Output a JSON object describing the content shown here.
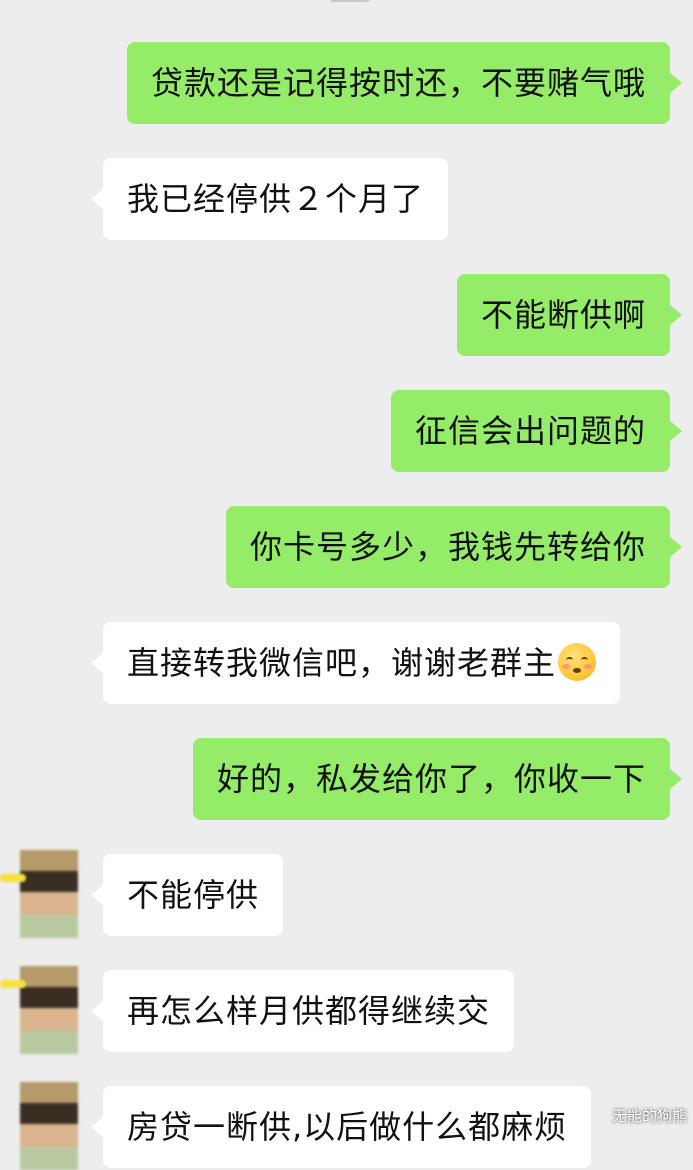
{
  "messages": [
    {
      "side": "sent",
      "text": "贷款还是记得按时还，不要赌气哦"
    },
    {
      "side": "received",
      "text": "我已经停供２个月了"
    },
    {
      "side": "sent",
      "text": "不能断供啊"
    },
    {
      "side": "sent",
      "text": "征信会出问题的"
    },
    {
      "side": "sent",
      "text": "你卡号多少，我钱先转给你"
    },
    {
      "side": "received",
      "text": "直接转我微信吧，谢谢老群主",
      "emoji": "blushing-face-icon"
    },
    {
      "side": "sent",
      "text": "好的，私发给你了，你收一下"
    },
    {
      "side": "received",
      "text": "不能停供",
      "avatar": true
    },
    {
      "side": "received",
      "text": "再怎么样月供都得继续交",
      "avatar": true
    },
    {
      "side": "received",
      "text": "房贷一断供,以后做什么都麻烦",
      "avatar": true
    }
  ],
  "watermark": "无能的狗熊",
  "colors": {
    "background": "#ededed",
    "sent_bubble": "#95ec69",
    "received_bubble": "#ffffff",
    "text": "#111111"
  }
}
